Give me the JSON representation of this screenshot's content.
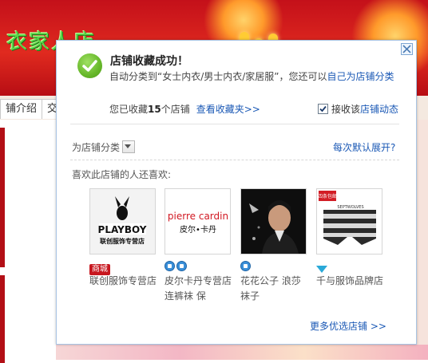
{
  "background": {
    "shop_logo": "衣家人店",
    "tabs": [
      "铺介绍",
      "交"
    ]
  },
  "popup": {
    "title": "店铺收藏成功！",
    "desc_prefix": "自动分类到“女士内衣/男士内衣/家居服”，您还可以",
    "desc_link": "自己为店铺分类",
    "count_prefix": "您已收藏",
    "count_value": "15",
    "count_suffix": "个店铺",
    "view_favorites": "查看收藏夹>>",
    "subscribe_prefix": "接收该",
    "subscribe_link": "店铺动态",
    "subscribe_checked": true,
    "category_label": "为店铺分类",
    "expand_link": "每次默认展开?",
    "also_like": "喜欢此店铺的人还喜欢:",
    "more_link": "更多优选店铺 >>",
    "shops": [
      {
        "name": "联创服饰专营店",
        "badge": "商城",
        "badge_type": "mall",
        "thumb_brand": "PLAYBOY",
        "thumb_sub": "联创服饰专营店"
      },
      {
        "name": "皮尔卡丹专营店 连裤袜 保",
        "badge": "",
        "badge_type": "crown",
        "badge_count": 2,
        "thumb_brand": "pierre cardin",
        "thumb_sub": "皮尔•卡丹"
      },
      {
        "name": "花花公子 浪莎袜子",
        "badge": "",
        "badge_type": "crown",
        "badge_count": 1,
        "thumb_brand": "",
        "thumb_sub": ""
      },
      {
        "name": "千与服饰品牌店",
        "badge": "",
        "badge_type": "diamond",
        "badge_count": 1,
        "thumb_brand": "SEPTWOLVES",
        "thumb_sub": "四条包邮"
      }
    ]
  },
  "colors": {
    "link": "#1a58b5",
    "banner_red": "#c4101a",
    "success_green": "#67b82a",
    "popup_border": "#a8c4e4"
  }
}
